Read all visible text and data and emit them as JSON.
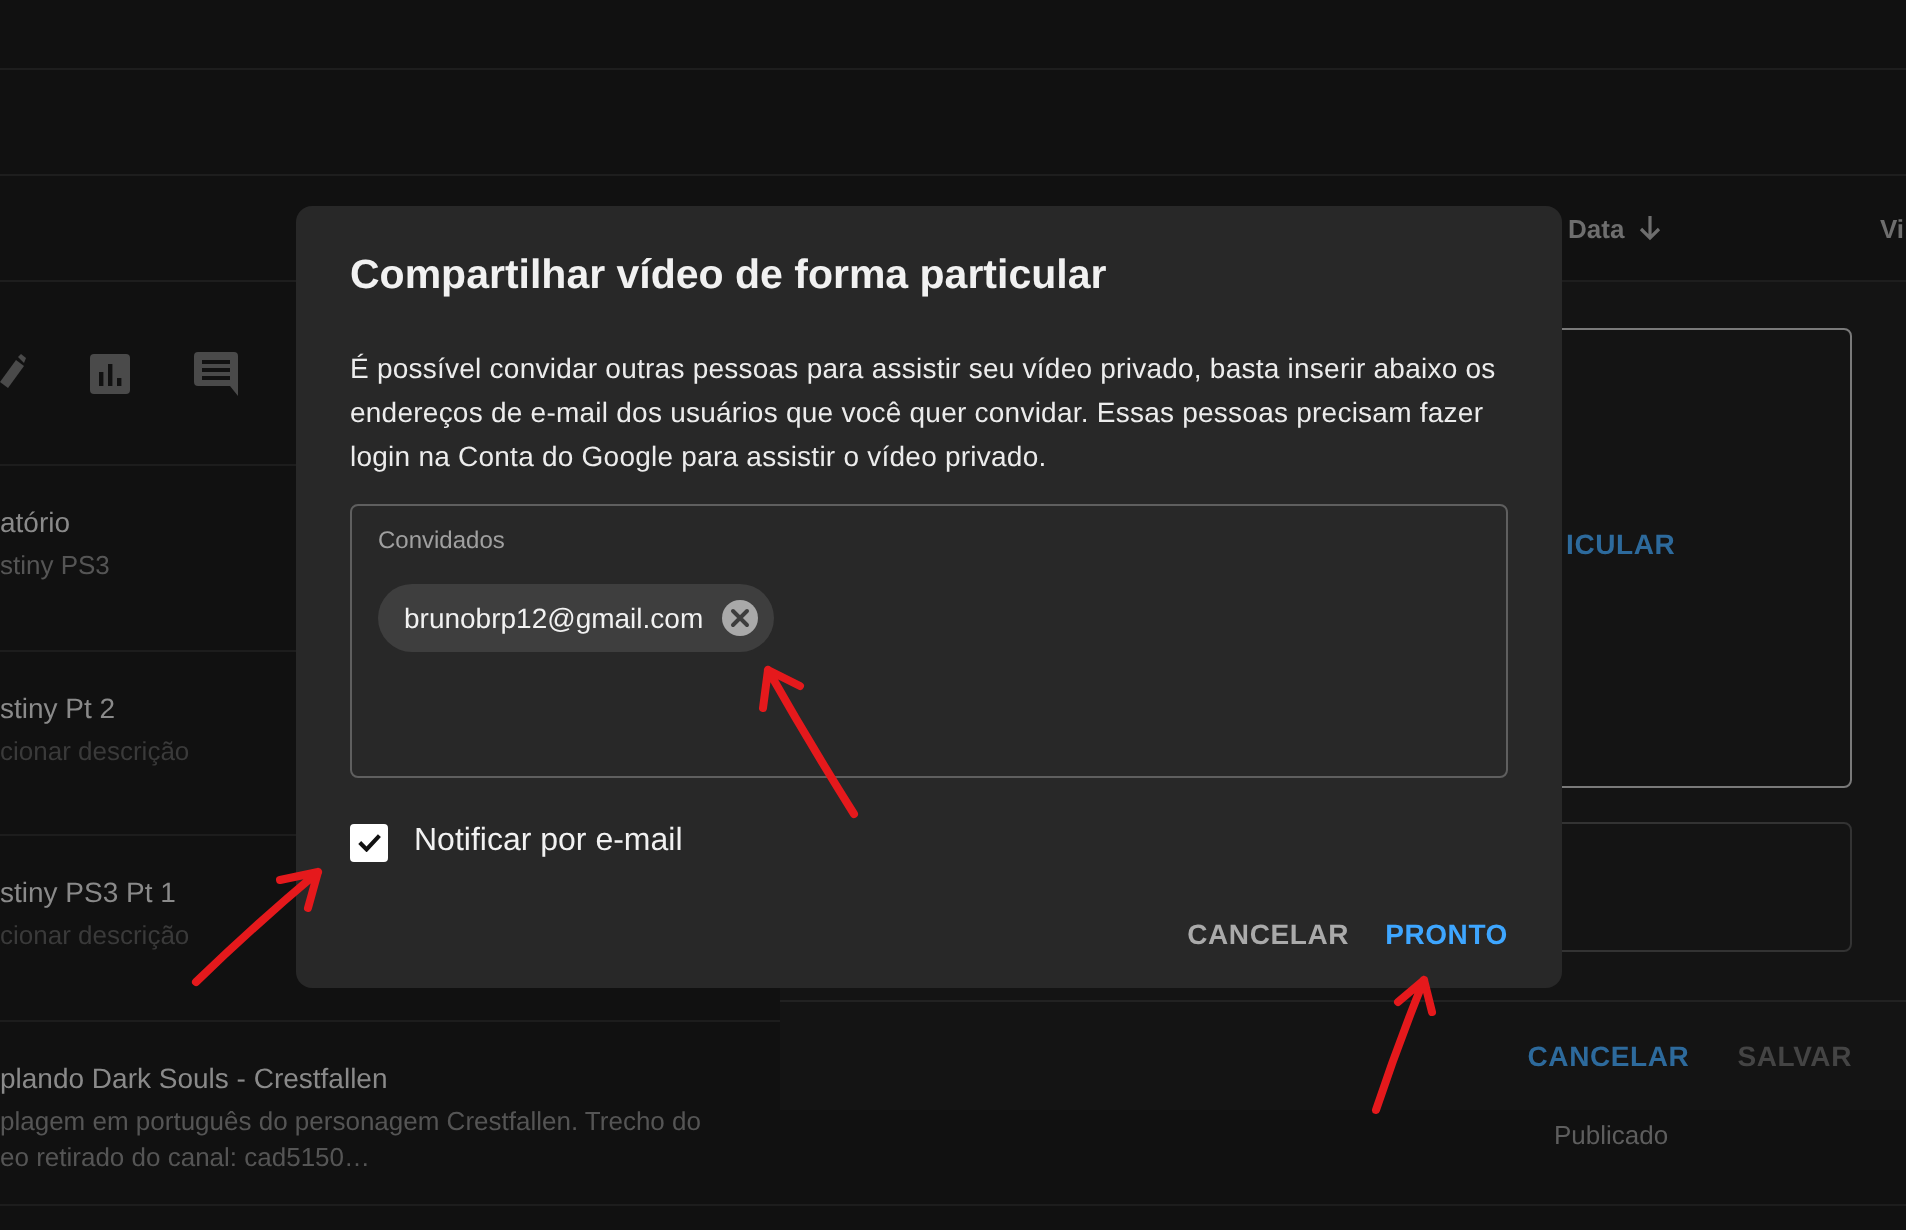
{
  "header": {
    "sort_column": "Data",
    "column_cut": "Vi"
  },
  "rows": [
    {
      "title": "atório",
      "description_lines": [
        "stiny PS3"
      ],
      "description_placeholder": false
    },
    {
      "title": "stiny Pt 2",
      "description_lines": [
        "cionar descrição"
      ],
      "description_placeholder": true
    },
    {
      "title": "stiny PS3 Pt 1",
      "description_lines": [
        "cionar descrição"
      ],
      "description_placeholder": true
    },
    {
      "title": "plando Dark Souls - Crestfallen",
      "description_lines": [
        "plagem em português do personagem Crestfallen. Trecho do",
        "eo retirado do canal: cad5150…"
      ],
      "description_placeholder": false,
      "status": "Publicado"
    }
  ],
  "visibility_panel": {
    "link_cut": "ICULAR",
    "buttons": [
      {
        "label": "CANCELAR",
        "disabled": false
      },
      {
        "label": "SALVAR",
        "disabled": true
      }
    ]
  },
  "dialog": {
    "title": "Compartilhar vídeo de forma particular",
    "description": "É possível convidar outras pessoas para assistir seu vídeo privado, basta inserir abaixo os endereços de e-mail dos usuários que você quer convidar. Essas pessoas precisam fazer login na Conta do Google para assistir o vídeo privado.",
    "invitees_field": {
      "label": "Convidados",
      "chips": [
        "brunobrp12@gmail.com"
      ]
    },
    "notify_checkbox": {
      "label": "Notificar por e-mail",
      "checked": true
    },
    "buttons": [
      {
        "label": "CANCELAR",
        "kind": "secondary"
      },
      {
        "label": "PRONTO",
        "kind": "primary"
      }
    ]
  }
}
